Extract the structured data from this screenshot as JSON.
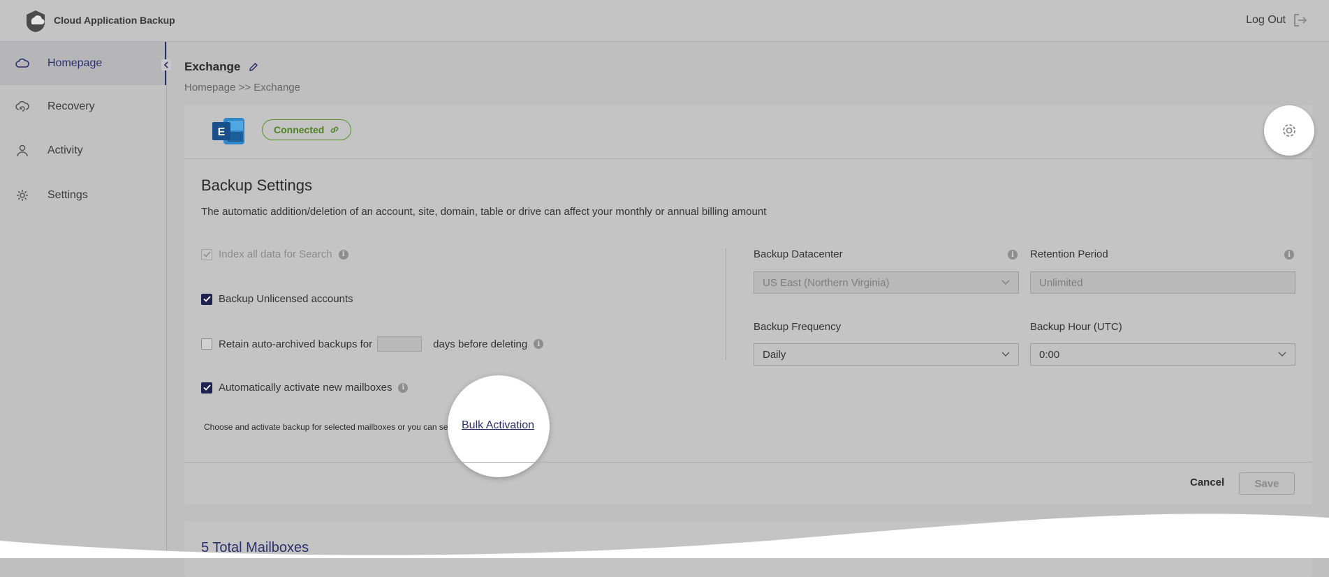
{
  "app": {
    "title": "Cloud Application Backup",
    "logout_label": "Log Out"
  },
  "sidebar": {
    "items": [
      {
        "label": "Homepage",
        "icon": "cloud-icon"
      },
      {
        "label": "Recovery",
        "icon": "cloud-restore-icon"
      },
      {
        "label": "Activity",
        "icon": "user-icon"
      },
      {
        "label": "Settings",
        "icon": "gear-icon"
      }
    ]
  },
  "page": {
    "title": "Exchange",
    "breadcrumb": {
      "home": "Homepage",
      "separator": ">>",
      "current": "Exchange"
    }
  },
  "connection": {
    "status": "Connected"
  },
  "backup": {
    "title": "Backup Settings",
    "description": "The automatic addition/deletion of an account, site, domain, table or drive can affect your monthly or annual billing amount",
    "options": {
      "index_label": "Index all data for Search",
      "unlicensed_label": "Backup Unlicensed accounts",
      "retain_label_pre": "Retain auto-archived backups for",
      "retain_label_post": "days before deleting",
      "retain_days_value": "",
      "auto_activate_label": "Automatically activate new mailboxes"
    },
    "fields": {
      "datacenter_label": "Backup Datacenter",
      "datacenter_value": "US East (Northern Virginia)",
      "retention_label": "Retention Period",
      "retention_placeholder": "Unlimited",
      "frequency_label": "Backup Frequency",
      "frequency_value": "Daily",
      "hour_label": "Backup Hour (UTC)",
      "hour_value": "0:00"
    },
    "bulk_text": "Choose and activate backup for selected mailboxes or you can se",
    "bulk_link": "Bulk Activation",
    "cancel_label": "Cancel",
    "save_label": "Save"
  },
  "mailboxes": {
    "title": "5 Total Mailboxes"
  },
  "colors": {
    "accent": "#2d2f6a",
    "connected": "#4f7f22",
    "overlay": "#bfbfbf"
  }
}
